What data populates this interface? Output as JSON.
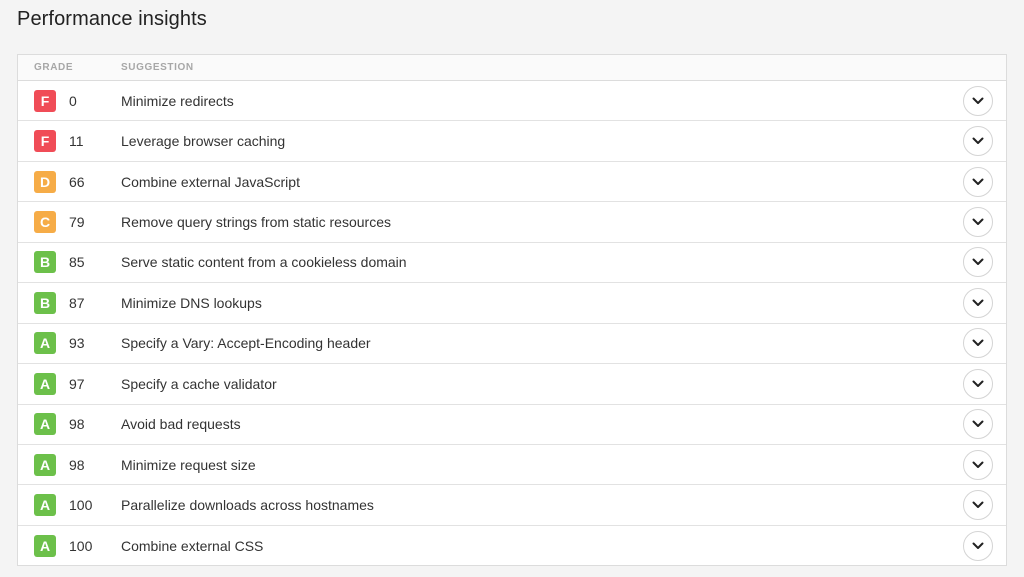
{
  "page": {
    "title": "Performance insights"
  },
  "table": {
    "headers": {
      "grade": "GRADE",
      "suggestion": "SUGGESTION"
    },
    "rows": [
      {
        "grade": "F",
        "score": "0",
        "suggestion": "Minimize redirects"
      },
      {
        "grade": "F",
        "score": "11",
        "suggestion": "Leverage browser caching"
      },
      {
        "grade": "D",
        "score": "66",
        "suggestion": "Combine external JavaScript"
      },
      {
        "grade": "C",
        "score": "79",
        "suggestion": "Remove query strings from static resources"
      },
      {
        "grade": "B",
        "score": "85",
        "suggestion": "Serve static content from a cookieless domain"
      },
      {
        "grade": "B",
        "score": "87",
        "suggestion": "Minimize DNS lookups"
      },
      {
        "grade": "A",
        "score": "93",
        "suggestion": "Specify a Vary: Accept-Encoding header"
      },
      {
        "grade": "A",
        "score": "97",
        "suggestion": "Specify a cache validator"
      },
      {
        "grade": "A",
        "score": "98",
        "suggestion": "Avoid bad requests"
      },
      {
        "grade": "A",
        "score": "98",
        "suggestion": "Minimize request size"
      },
      {
        "grade": "A",
        "score": "100",
        "suggestion": "Parallelize downloads across hostnames"
      },
      {
        "grade": "A",
        "score": "100",
        "suggestion": "Combine external CSS"
      }
    ]
  },
  "colors": {
    "grade_F": "#f04c57",
    "grade_D": "#f6ac47",
    "grade_C": "#f6ac47",
    "grade_B": "#6cc04a",
    "grade_A": "#6cc04a"
  },
  "icons": {
    "expand": "chevron-down-icon"
  }
}
